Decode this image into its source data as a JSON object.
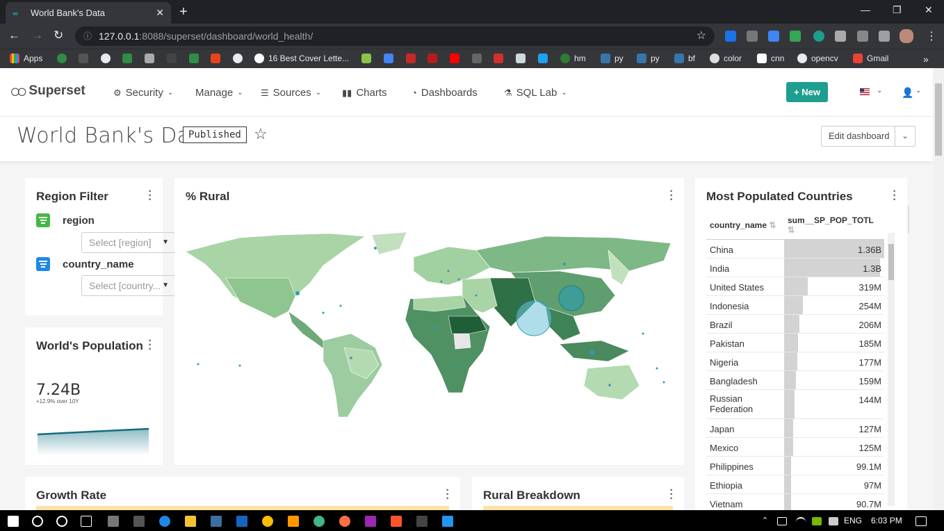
{
  "browser": {
    "tab_title": "World Bank's Data",
    "url_host": "127.0.0.1",
    "url_rest": ":8088/superset/dashboard/world_health/",
    "bookmarks": [
      "Apps",
      "16 Best Cover Lette...",
      "hm",
      "py",
      "py",
      "bf",
      "color",
      "cnn",
      "opencv",
      "Gmail"
    ]
  },
  "navbar": {
    "brand": "Superset",
    "menu": [
      "Security",
      "Manage",
      "Sources",
      "Charts",
      "Dashboards",
      "SQL Lab"
    ],
    "new_button": "+ New"
  },
  "dashboard": {
    "title": "World Bank's Data",
    "status": "Published",
    "edit_button": "Edit dashboard"
  },
  "region_filter": {
    "title": "Region Filter",
    "filters": [
      {
        "label": "region",
        "placeholder": "Select [region]",
        "color": "#44b846"
      },
      {
        "label": "country_name",
        "placeholder": "Select [country...",
        "color": "#1e88e5"
      }
    ]
  },
  "world_population": {
    "title": "World's Population",
    "value": "7.24B",
    "subtext": "+12.9% over 10Y"
  },
  "rural_map": {
    "title": "% Rural"
  },
  "most_populated": {
    "title": "Most Populated Countries",
    "columns": [
      "country_name",
      "sum__SP_POP_TOTL"
    ]
  },
  "growth_rate": {
    "title": "Growth Rate"
  },
  "rural_breakdown": {
    "title": "Rural Breakdown"
  },
  "taskbar": {
    "lang": "ENG",
    "time": "6:03 PM"
  },
  "chart_data": {
    "type": "table",
    "columns": [
      "country_name",
      "sum__SP_POP_TOTL"
    ],
    "rows": [
      {
        "country": "China",
        "label": "1.36B",
        "value": 1360
      },
      {
        "country": "India",
        "label": "1.3B",
        "value": 1300
      },
      {
        "country": "United States",
        "label": "319M",
        "value": 319
      },
      {
        "country": "Indonesia",
        "label": "254M",
        "value": 254
      },
      {
        "country": "Brazil",
        "label": "206M",
        "value": 206
      },
      {
        "country": "Pakistan",
        "label": "185M",
        "value": 185
      },
      {
        "country": "Nigeria",
        "label": "177M",
        "value": 177
      },
      {
        "country": "Bangladesh",
        "label": "159M",
        "value": 159
      },
      {
        "country": "Russian Federation",
        "label": "144M",
        "value": 144
      },
      {
        "country": "Japan",
        "label": "127M",
        "value": 127
      },
      {
        "country": "Mexico",
        "label": "125M",
        "value": 125
      },
      {
        "country": "Philippines",
        "label": "99.1M",
        "value": 99.1
      },
      {
        "country": "Ethiopia",
        "label": "97M",
        "value": 97
      },
      {
        "country": "Vietnam",
        "label": "90.7M",
        "value": 90.7
      }
    ]
  }
}
